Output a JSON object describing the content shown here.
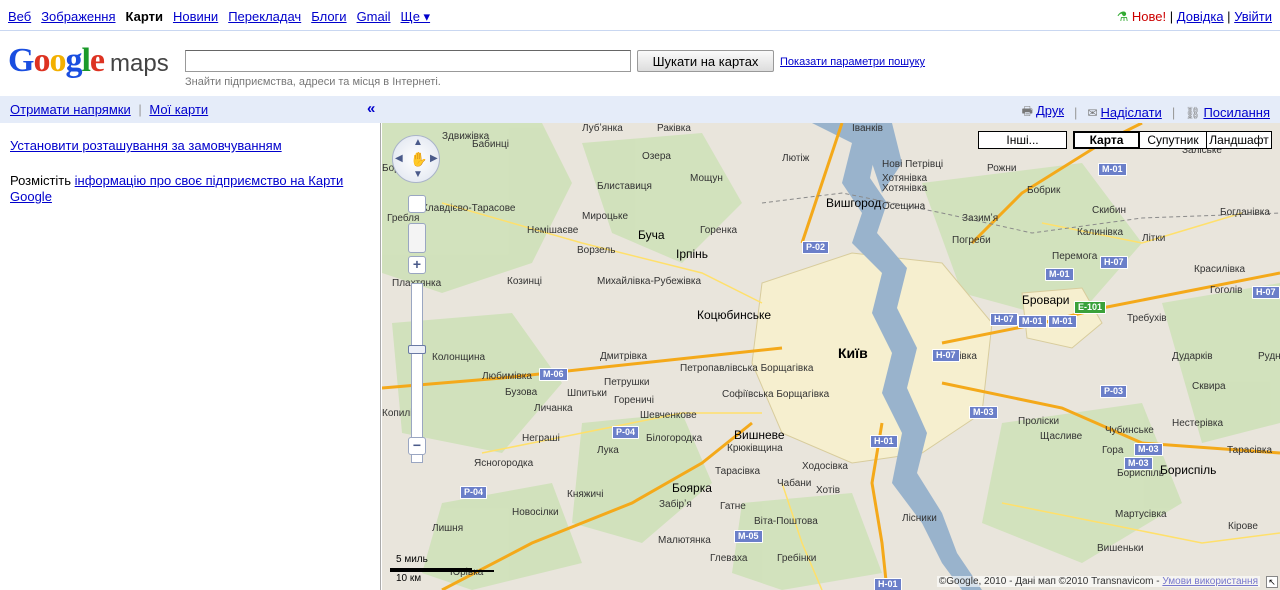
{
  "topnav": {
    "items": [
      "Веб",
      "Зображення",
      "Карти",
      "Новини",
      "Перекладач",
      "Блоги",
      "Gmail",
      "Ще ▾"
    ],
    "new_label": "Нове!",
    "help_label": "Довідка",
    "signin_label": "Увійти",
    "separator": "|"
  },
  "header": {
    "logo_text": "Google",
    "logo_suffix": "maps",
    "search_value": "",
    "search_button": "Шукати на картах",
    "advanced_link": "Показати параметри пошуку",
    "hint": "Знайти підприємства, адреси та місця в Інтернеті."
  },
  "subbar": {
    "directions": "Отримати напрямки",
    "my_maps": "Мої карти",
    "collapse": "«",
    "print": "Друк",
    "send": "Надіслати",
    "link": "Посилання"
  },
  "leftpanel": {
    "default_location": "Установити розташування за замовчуванням",
    "business_prefix": "Розмістіть ",
    "business_link": "інформацію про своє підприємство на Карти Google"
  },
  "map": {
    "types": [
      "Інші...",
      "Карта",
      "Супутник",
      "Ландшафт"
    ],
    "selected_type": "Карта",
    "scale_top": "5 миль",
    "scale_bottom": "10 км",
    "copyright": "©Google, 2010 - Дані мап ©2010 Transnavicom - ",
    "terms": "Умови використання",
    "city": "Київ",
    "big_places": [
      "Вишгород",
      "Бровари",
      "Ірпінь",
      "Буча",
      "Бориспіль",
      "Боярка",
      "Вишневе",
      "Коцюбинське",
      "Гатне",
      "Софіївська Борщагівка",
      "Петропавлівська Борщагівка"
    ],
    "places": [
      {
        "t": "Лубʼянка"
      },
      {
        "t": "Раківка"
      },
      {
        "t": "Бабинці"
      },
      {
        "t": "Озера"
      },
      {
        "t": "Здвижівка"
      },
      {
        "t": "Лютіж"
      },
      {
        "t": "Нові Петрівці"
      },
      {
        "t": "Хотянівка"
      },
      {
        "t": "Зазимʼя"
      },
      {
        "t": "Погреби"
      },
      {
        "t": "Калинівка"
      },
      {
        "t": "Рожни"
      },
      {
        "t": "Заліське"
      },
      {
        "t": "Бобрик"
      },
      {
        "t": "Мощун"
      },
      {
        "t": "Бородянка"
      },
      {
        "t": "Блиставиця"
      },
      {
        "t": "Клавдієво-Тарасове"
      },
      {
        "t": "Немішаєве"
      },
      {
        "t": "Мироцьке"
      },
      {
        "t": "Горенка"
      },
      {
        "t": "Ворзель"
      },
      {
        "t": "Михайлівка-Рубежівка"
      },
      {
        "t": "Козинці"
      },
      {
        "t": "Колонщина"
      },
      {
        "t": "Любимівка"
      },
      {
        "t": "Дмитрівка"
      },
      {
        "t": "Петрушки"
      },
      {
        "t": "Бузова"
      },
      {
        "t": "Шпитьки"
      },
      {
        "t": "Гореничі"
      },
      {
        "t": "Личанка"
      },
      {
        "t": "Шевченкове"
      },
      {
        "t": "Неграші"
      },
      {
        "t": "Білогородка"
      },
      {
        "t": "Лука"
      },
      {
        "t": "Ясногородка"
      },
      {
        "t": "Княжичі"
      },
      {
        "t": "Тарасівка"
      },
      {
        "t": "Чабани"
      },
      {
        "t": "Хотів"
      },
      {
        "t": "Віта-Поштова"
      },
      {
        "t": "Забірʼя"
      },
      {
        "t": "Малютянка"
      },
      {
        "t": "Глеваха"
      },
      {
        "t": "Гребінки"
      },
      {
        "t": "Новосілки"
      },
      {
        "t": "Крюківщина"
      },
      {
        "t": "Пухівка"
      },
      {
        "t": "Требухів"
      },
      {
        "t": "Дударків"
      },
      {
        "t": "Проліски"
      },
      {
        "t": "Щасливе"
      },
      {
        "t": "Чубинське"
      },
      {
        "t": "Гора"
      },
      {
        "t": "Нестерівка"
      },
      {
        "t": "Красилівка"
      },
      {
        "t": "Богданівка"
      },
      {
        "t": "Гоголів"
      },
      {
        "t": "Рудня"
      },
      {
        "t": "Перемога"
      },
      {
        "t": "Скибин"
      },
      {
        "t": "Літки"
      },
      {
        "t": "Тарасівка"
      },
      {
        "t": "Бориспіль"
      },
      {
        "t": "Мартусівка"
      },
      {
        "t": "Кірове"
      },
      {
        "t": "Вишеньки"
      },
      {
        "t": "Лісники"
      },
      {
        "t": "Ходосівка"
      },
      {
        "t": "Іванків"
      },
      {
        "t": "Хотянівка"
      },
      {
        "t": "Осещина"
      },
      {
        "t": "Сквира"
      },
      {
        "t": "Лишня"
      },
      {
        "t": "Юрівка"
      },
      {
        "t": "Плахтянка"
      },
      {
        "t": "Копилів"
      },
      {
        "t": "Гребля"
      }
    ],
    "shields": [
      {
        "t": "P-02"
      },
      {
        "t": "M-06"
      },
      {
        "t": "M-01"
      },
      {
        "t": "H-07"
      },
      {
        "t": "E-101",
        "green": true
      },
      {
        "t": "P-04"
      },
      {
        "t": "H-01"
      },
      {
        "t": "M-03"
      },
      {
        "t": "P-03"
      },
      {
        "t": "M-05"
      }
    ]
  }
}
